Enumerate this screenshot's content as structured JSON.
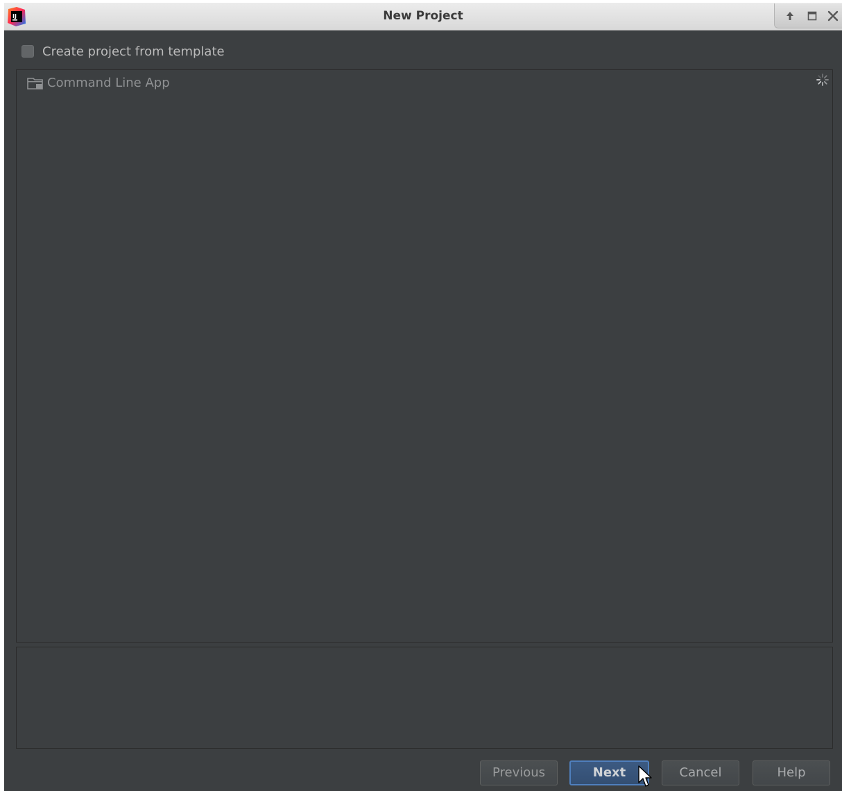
{
  "window": {
    "title": "New Project",
    "app_icon": "intellij-idea-logo-icon",
    "controls": [
      "window-up-icon",
      "window-maximize-icon",
      "window-close-icon"
    ]
  },
  "template_option": {
    "label": "Create project from template",
    "checked": false
  },
  "template_list": {
    "items": [
      {
        "label": "Command Line App",
        "icon": "folder-template-icon"
      }
    ],
    "loading_icon": "spinner-icon"
  },
  "footer": {
    "previous_label": "Previous",
    "next_label": "Next",
    "cancel_label": "Cancel",
    "help_label": "Help"
  },
  "colors": {
    "background": "#3c3f41",
    "titlebar": "#dcdcdc",
    "default_button": "#3c5a82",
    "accent_border": "#4f7fbd"
  }
}
